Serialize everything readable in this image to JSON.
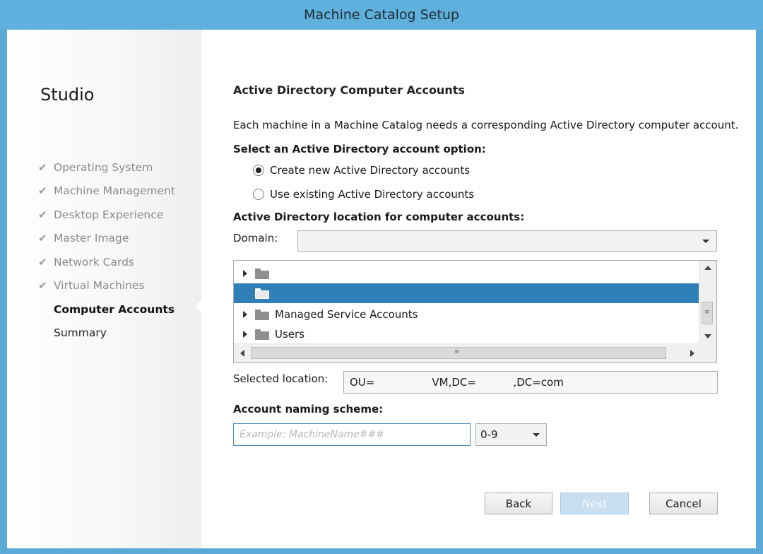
{
  "window": {
    "title": "Machine Catalog Setup"
  },
  "sidebar": {
    "title": "Studio",
    "steps": [
      {
        "label": "Operating System",
        "state": "done"
      },
      {
        "label": "Machine Management",
        "state": "done"
      },
      {
        "label": "Desktop Experience",
        "state": "done"
      },
      {
        "label": "Master Image",
        "state": "done"
      },
      {
        "label": "Network Cards",
        "state": "done"
      },
      {
        "label": "Virtual Machines",
        "state": "done"
      },
      {
        "label": "Computer Accounts",
        "state": "current"
      },
      {
        "label": "Summary",
        "state": "pending"
      }
    ],
    "check_glyph": "✔"
  },
  "main": {
    "heading": "Active Directory Computer Accounts",
    "description": "Each machine in a Machine Catalog needs a corresponding Active Directory computer account.",
    "option_label": "Select an Active Directory account option:",
    "options": [
      {
        "label": "Create new Active Directory accounts",
        "selected": true
      },
      {
        "label": "Use existing Active Directory accounts",
        "selected": false
      }
    ],
    "location_label": "Active Directory location for computer accounts:",
    "domain_label": "Domain:",
    "domain_value": "",
    "tree": {
      "rows": [
        {
          "label": "",
          "expandable": true,
          "selected": false
        },
        {
          "label": "",
          "expandable": false,
          "selected": true
        },
        {
          "label": "Managed Service Accounts",
          "expandable": true,
          "selected": false
        },
        {
          "label": "Users",
          "expandable": true,
          "selected": false
        }
      ],
      "h_scroll_grip": "≡",
      "v_scroll_grip": "≡"
    },
    "selected_location_label": "Selected location:",
    "selected_location_value": "OU=                 VM,DC=           ,DC=com",
    "naming_label": "Account naming scheme:",
    "naming_placeholder": "Example: MachineName###",
    "naming_scheme_value": "0-9"
  },
  "buttons": {
    "back": "Back",
    "next": "Next",
    "cancel": "Cancel"
  },
  "colors": {
    "titlebar": "#5fb0dd",
    "selection": "#2f7fb9",
    "next_disabled": "#c7dff0"
  }
}
